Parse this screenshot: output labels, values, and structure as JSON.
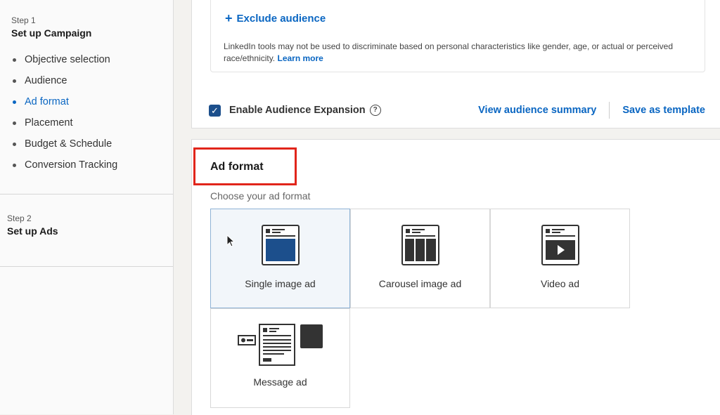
{
  "sidebar": {
    "step1": {
      "num": "Step 1",
      "title": "Set up Campaign"
    },
    "items": [
      {
        "label": "Objective selection"
      },
      {
        "label": "Audience"
      },
      {
        "label": "Ad format"
      },
      {
        "label": "Placement"
      },
      {
        "label": "Budget & Schedule"
      },
      {
        "label": "Conversion Tracking"
      }
    ],
    "active_item": "Ad format",
    "step2": {
      "num": "Step 2",
      "title": "Set up Ads"
    }
  },
  "audience": {
    "exclude_label": "Exclude audience",
    "disclaimer": "LinkedIn tools may not be used to discriminate based on personal characteristics like gender, age, or actual or perceived race/ethnicity.",
    "learn_more": "Learn more",
    "expansion_label": "Enable Audience Expansion",
    "expansion_checked": true,
    "view_summary": "View audience summary",
    "save_template": "Save as template"
  },
  "ad_format": {
    "title": "Ad format",
    "subtitle": "Choose your ad format",
    "options": [
      {
        "label": "Single image ad",
        "selected": true
      },
      {
        "label": "Carousel image ad",
        "selected": false
      },
      {
        "label": "Video ad",
        "selected": false
      },
      {
        "label": "Message ad",
        "selected": false
      }
    ]
  },
  "colors": {
    "accent": "#0a66c2",
    "highlight": "#e1251b",
    "checkbox": "#1c4f8c"
  }
}
